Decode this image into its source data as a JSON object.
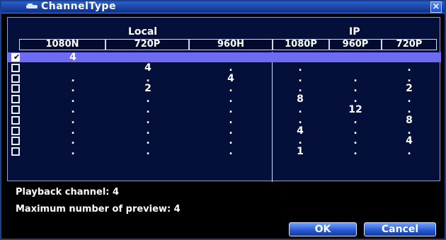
{
  "window": {
    "title": "ChannelType",
    "close_label": "×"
  },
  "groups": {
    "local": "Local",
    "ip": "IP"
  },
  "columns": [
    "1080N",
    "720P",
    "960H",
    "1080P",
    "960P",
    "720P"
  ],
  "rows": [
    {
      "checked": true,
      "values": [
        "4",
        "",
        "",
        "",
        "",
        ""
      ]
    },
    {
      "checked": false,
      "values": [
        "",
        "4",
        ".",
        ".",
        "",
        "."
      ]
    },
    {
      "checked": false,
      "values": [
        ".",
        ".",
        "4",
        ".",
        ".",
        "."
      ]
    },
    {
      "checked": false,
      "values": [
        ".",
        "2",
        ".",
        ".",
        ".",
        "2"
      ]
    },
    {
      "checked": false,
      "values": [
        ".",
        ".",
        ".",
        "8",
        ".",
        "."
      ]
    },
    {
      "checked": false,
      "values": [
        ".",
        ".",
        ".",
        ".",
        "12",
        "."
      ]
    },
    {
      "checked": false,
      "values": [
        ".",
        ".",
        ".",
        ".",
        ".",
        "8"
      ]
    },
    {
      "checked": false,
      "values": [
        ".",
        ".",
        ".",
        "4",
        ".",
        "."
      ]
    },
    {
      "checked": false,
      "values": [
        ".",
        ".",
        ".",
        ".",
        ".",
        "4"
      ]
    },
    {
      "checked": false,
      "values": [
        ".",
        ".",
        ".",
        "1",
        ".",
        "."
      ]
    }
  ],
  "info": {
    "playback": "Playback channel: 4",
    "preview": "Maximum number of preview: 4"
  },
  "buttons": {
    "ok": "OK",
    "cancel": "Cancel"
  },
  "colors": {
    "title_bar": "#1d4fc8",
    "selected_row": "#6f6af2",
    "panel_bg": "#04103a",
    "button_blue": "#2556cf"
  }
}
